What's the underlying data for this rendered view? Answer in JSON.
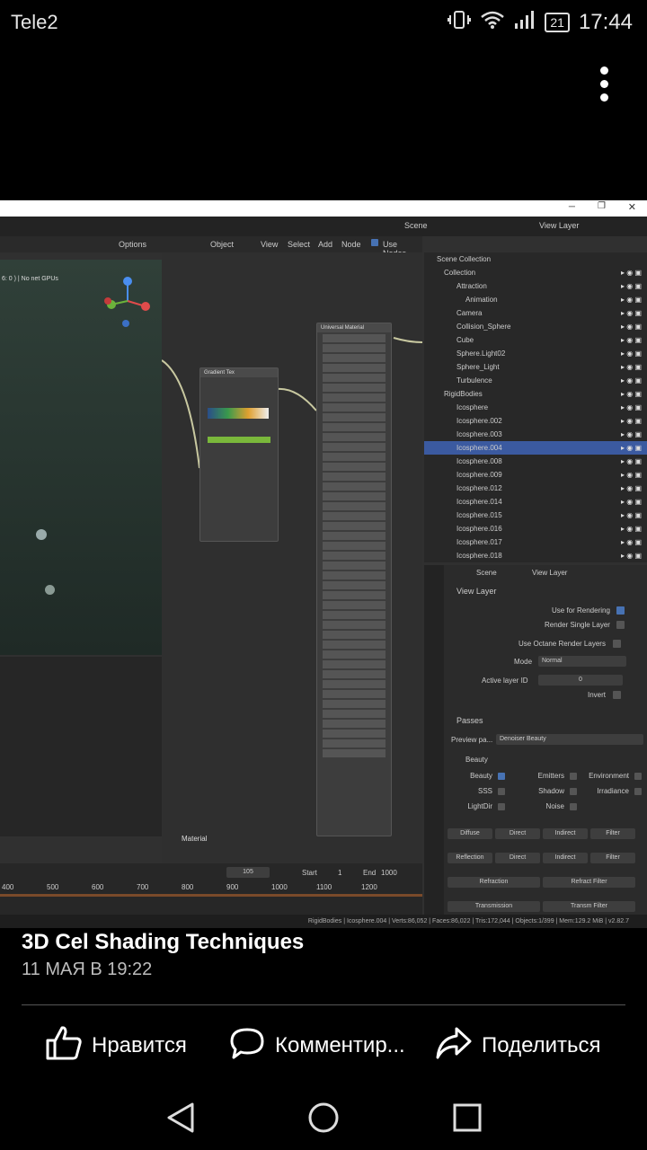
{
  "status_bar": {
    "carrier": "Tele2",
    "battery": "21",
    "time": "17:44"
  },
  "photo": {
    "blender": {
      "scene_label": "Scene",
      "view_layer_label": "View Layer",
      "options_label": "Options",
      "object_label": "Object",
      "menu": [
        "View",
        "Select",
        "Add",
        "Node"
      ],
      "use_nodes_label": "Use Nodes",
      "viewport_info": "6: 0 ) | No net GPUs",
      "material_label": "Material",
      "outliner": {
        "title": "Scene Collection",
        "rows": [
          "Collection",
          "Attraction",
          "Animation",
          "Camera",
          "Collision_Sphere",
          "Cube",
          "Sphere.Light02",
          "Sphere_Light",
          "Turbulence",
          "RigidBodies",
          "Icosphere",
          "Icosphere.002",
          "Icosphere.003",
          "Icosphere.004",
          "Icosphere.008",
          "Icosphere.009",
          "Icosphere.012",
          "Icosphere.014",
          "Icosphere.015",
          "Icosphere.016",
          "Icosphere.017",
          "Icosphere.018"
        ],
        "selected_index": 13
      },
      "properties": {
        "scene": "Scene",
        "view_layer": "View Layer",
        "section_view_layer": "View Layer",
        "use_for_rendering": "Use for Rendering",
        "render_single_layer": "Render Single Layer",
        "use_octane_render_layers": "Use Octane Render Layers",
        "mode_label": "Mode",
        "mode_value": "Normal",
        "active_layer_id_label": "Active layer ID",
        "active_layer_id_value": "0",
        "invert_label": "Invert",
        "passes": "Passes",
        "preview_pass_label": "Preview pa...",
        "preview_pass_value": "Denoiser Beauty",
        "beauty": "Beauty",
        "beauty_items": [
          "Beauty",
          "Emitters",
          "Environment",
          "SSS",
          "Shadow",
          "Irradiance",
          "LightDir",
          "Noise"
        ],
        "buttons_row1": [
          "Diffuse",
          "Direct",
          "Indirect",
          "Filter"
        ],
        "buttons_row2": [
          "Reflection",
          "Direct",
          "Indirect",
          "Filter"
        ],
        "buttons_row3": [
          "Refraction",
          "Refract Filter"
        ],
        "buttons_row4": [
          "Transmission",
          "Transm Filter"
        ]
      },
      "timeline": {
        "frame": "105",
        "start_label": "Start",
        "start_value": "1",
        "end_label": "End",
        "end_value": "1000",
        "ticks": [
          "400",
          "500",
          "600",
          "700",
          "800",
          "900",
          "1000",
          "1100",
          "1200"
        ]
      },
      "statusline": "RigidBodies | Icosphere.004 | Verts:86,052 | Faces:86,022 | Tris:172,044 | Objects:1/399 | Mem:129.2 MiB | v2.82.7"
    }
  },
  "post": {
    "title": "3D Cel Shading Techniques",
    "date": "11 МАЯ В 19:22"
  },
  "actions": {
    "like": "Нравится",
    "comment": "Комментир...",
    "share": "Поделиться"
  }
}
